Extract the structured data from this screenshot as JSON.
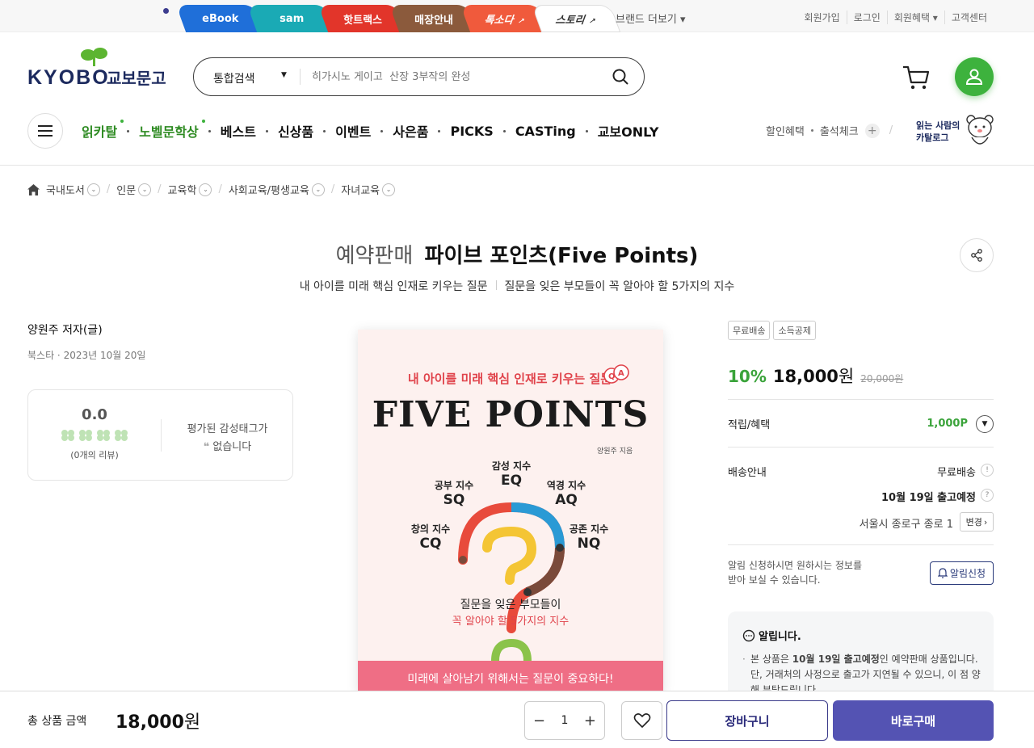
{
  "top_tabs": [
    {
      "label": "eBook",
      "color": "#1f6fd9",
      "ext": ""
    },
    {
      "label": "sam",
      "color": "#1aaab5",
      "ext": ""
    },
    {
      "label": "핫트랙스",
      "color": "#e2352a",
      "ext": ""
    },
    {
      "label": "매장안내",
      "color": "#8b5a3c",
      "ext": ""
    },
    {
      "label": "톡소다",
      "color": "#f05a3c",
      "ext": "↗"
    },
    {
      "label": "스토리",
      "color": "#ffffff",
      "ext": "↗"
    }
  ],
  "brand_more": "브랜드 더보기 ▾",
  "top_links": [
    "회원가입",
    "로그인",
    "회원혜택 ▾",
    "고객센터"
  ],
  "logo": {
    "en": "KYOBO",
    "kr": "교보문고"
  },
  "search": {
    "category": "통합검색",
    "placeholder": "히가시노 게이고  산장 3부작의 완성"
  },
  "gnb": [
    {
      "label": "읽카탈",
      "green": true,
      "dot": true
    },
    {
      "label": "노벨문학상",
      "green": true,
      "dot": true
    },
    {
      "label": "베스트",
      "green": false,
      "dot": false
    },
    {
      "label": "신상품",
      "green": false,
      "dot": false
    },
    {
      "label": "이벤트",
      "green": false,
      "dot": false
    },
    {
      "label": "사은품",
      "green": false,
      "dot": false
    },
    {
      "label": "PICKS",
      "green": false,
      "dot": false
    },
    {
      "label": "CASTing",
      "green": false,
      "dot": false
    },
    {
      "label": "교보ONLY",
      "green": false,
      "dot": false
    }
  ],
  "gnb_right": {
    "discount": "할인혜택",
    "attendance": "출석체크",
    "catalog_line1": "읽는 사람의",
    "catalog_line2": "카탈로그"
  },
  "breadcrumb": [
    "국내도서",
    "인문",
    "교육학",
    "사회교육/평생교육",
    "자녀교육"
  ],
  "title": {
    "prefix": "예약판매",
    "name": "파이브 포인츠(Five Points)"
  },
  "subtitle": {
    "part1": "내 아이를 미래 핵심 인재로 키우는 질문",
    "part2": "질문을 잊은 부모들이 꼭 알아야 할 5가지의 지수"
  },
  "author": "양원주 저자(글)",
  "publisher_date": "북스타 · 2023년 10월 20일",
  "review": {
    "score": "0.0",
    "count": "(0개의 리뷰)",
    "tag_line1": "평가된 감성태그가",
    "tag_line2": "없습니다",
    "rating": 0
  },
  "cover": {
    "top_line": "내 아이를 미래 핵심 인재로 키우는 질문",
    "title": "FIVE POINTS",
    "author": "양원주 지음",
    "quotients": [
      {
        "name": "감성 지수",
        "abbr": "EQ"
      },
      {
        "name": "공부 지수",
        "abbr": "SQ"
      },
      {
        "name": "역경 지수",
        "abbr": "AQ"
      },
      {
        "name": "창의 지수",
        "abbr": "CQ"
      },
      {
        "name": "공존 지수",
        "abbr": "NQ"
      }
    ],
    "question_line1": "질문을 잊은 부모들이",
    "question_line2": "꼭 알아야 할 5가지의 지수",
    "band": "미래에 살아남기 위해서는 질문이 중요하다!"
  },
  "badges": [
    "무료배송",
    "소득공제"
  ],
  "price": {
    "discount": "10%",
    "amount": "18,000",
    "unit": "원",
    "original": "20,000원"
  },
  "points": {
    "label": "적립/혜택",
    "value": "1,000P"
  },
  "delivery": {
    "label": "배송안내",
    "shipping": "무료배송",
    "release": "10월 19일 출고예정",
    "address": "서울시 종로구 종로 1",
    "change": "변경"
  },
  "notify": {
    "line1": "알림 신청하시면 원하시는 정보를",
    "line2": "받아 보실 수 있습니다.",
    "button": "알림신청"
  },
  "notice": {
    "title": "알립니다.",
    "body_1": "본 상품은 ",
    "body_bold": "10월 19일 출고예정",
    "body_2": "인 예약판매 상품입니다. 단, 거래처의 사정으로 출고가 지연될 수 있으니, 이 점 양해 부탁드립니다."
  },
  "bottom": {
    "total_label": "총 상품 금액",
    "total_amount": "18,000",
    "unit": "원",
    "qty": "1",
    "cart": "장바구니",
    "buy": "바로구매"
  },
  "colors": {
    "green": "#3db23d",
    "navy": "#1c2a5e",
    "buy": "#5453b3",
    "cover_pink": "#ef6e85"
  }
}
